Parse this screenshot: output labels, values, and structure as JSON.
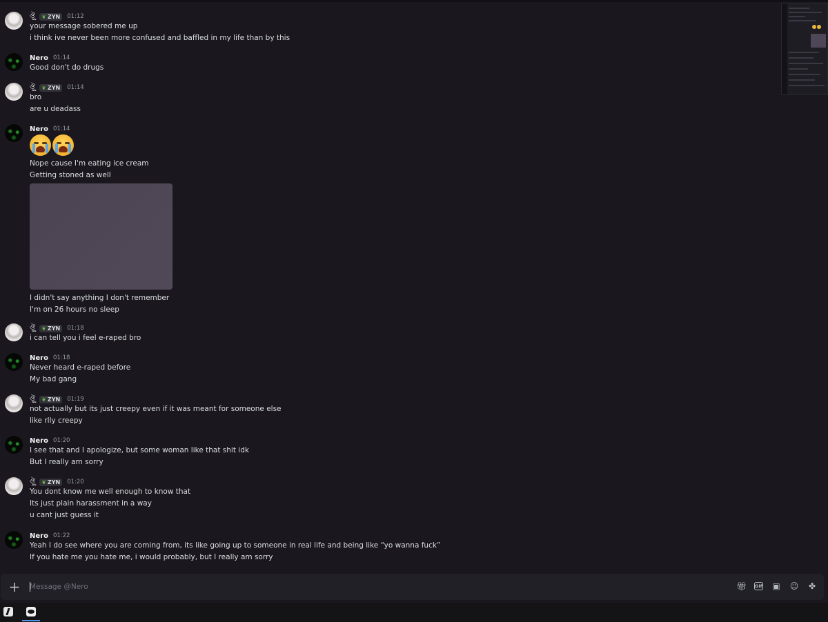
{
  "channel": {
    "composer_placeholder": "Message @Nero"
  },
  "users": {
    "zyn_user": {
      "display_symbols": "ঔৣ",
      "tag": "ZYN",
      "tag_icon": "leaf-icon"
    },
    "nero": {
      "name": "Nero"
    }
  },
  "messages": [
    {
      "author": "ঔৣ",
      "tag": "ZYN",
      "time": "01:12",
      "lines": [
        "your message sobered me up",
        "i think ive never been more confused and baffled in my life than by this"
      ]
    },
    {
      "author": "Nero",
      "time": "01:14",
      "lines": [
        "Good don't do drugs"
      ]
    },
    {
      "author": "ঔৣ",
      "tag": "ZYN",
      "time": "01:14",
      "lines": [
        "bro",
        "are u deadass"
      ]
    },
    {
      "author": "Nero",
      "time": "01:14",
      "emoji": [
        "loudly-crying-face",
        "loudly-crying-face"
      ],
      "lines": [
        "Nope cause I'm eating ice cream",
        "Getting stoned as well"
      ],
      "lines_after_image": [
        "I didn't say anything I don't remember",
        "I'm on 26 hours no sleep"
      ]
    },
    {
      "author": "ঔৣ",
      "tag": "ZYN",
      "time": "01:18",
      "lines": [
        "i can tell you i feel e-raped bro"
      ]
    },
    {
      "author": "Nero",
      "time": "01:18",
      "lines": [
        "Never heard e-raped before",
        "My bad gang"
      ]
    },
    {
      "author": "ঔৣ",
      "tag": "ZYN",
      "time": "01:19",
      "lines": [
        "not actually but its just creepy even if it was meant for someone else",
        "like rlly creepy"
      ]
    },
    {
      "author": "Nero",
      "time": "01:20",
      "lines": [
        "I see that and I apologize,  but some woman like that shit idk",
        "But I really am sorry"
      ]
    },
    {
      "author": "ঔৣ",
      "tag": "ZYN",
      "time": "01:20",
      "lines": [
        "You dont know me well enough to know that",
        "Its just plain harassment in a way",
        "u cant just guess it"
      ]
    },
    {
      "author": "Nero",
      "time": "01:22",
      "lines": [
        "Yeah I do see where you are coming from, its like going up to someone in real life and being like “yo wanna fuck”",
        "If you hate me you hate me, i would probably, but I really am sorry"
      ]
    }
  ],
  "composer": {
    "tools": {
      "gift": "gift-icon",
      "gif": "GIF",
      "sticker": "sticker-icon",
      "emoji": "emoji-icon",
      "apps": "apps-icon"
    }
  },
  "colors": {
    "background": "#1a181e",
    "composer": "#222027",
    "text": "#dbdee1",
    "muted": "#949ba4",
    "image_placeholder": "#4e4757",
    "taskbar_active": "#4e93e6"
  }
}
